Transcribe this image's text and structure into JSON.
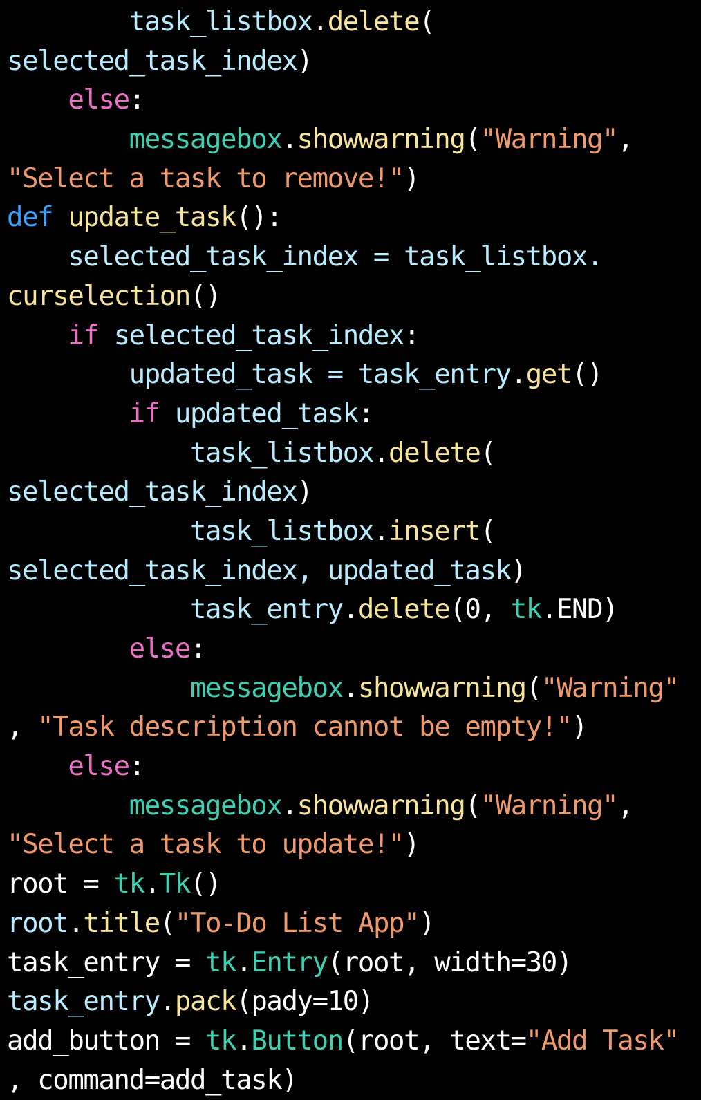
{
  "colors": {
    "background": "#000000",
    "plain": "#ffffff",
    "function": "#f6e59a",
    "keyword_def": "#3aa3ff",
    "keyword": "#ec6fc6",
    "string": "#ef9a6c",
    "module": "#3fd0b3",
    "property": "#b9ecff",
    "number": "#ffffff"
  },
  "lines": [
    [
      {
        "t": "        "
      },
      {
        "t": "task_listbox",
        "c": "property"
      },
      {
        "t": "."
      },
      {
        "t": "delete",
        "c": "function"
      },
      {
        "t": "("
      }
    ],
    [
      {
        "t": "selected_task_index",
        "c": "property"
      },
      {
        "t": ")"
      }
    ],
    [
      {
        "t": "    "
      },
      {
        "t": "else",
        "c": "keyword"
      },
      {
        "t": ":"
      }
    ],
    [
      {
        "t": "        "
      },
      {
        "t": "messagebox",
        "c": "module"
      },
      {
        "t": "."
      },
      {
        "t": "showwarning",
        "c": "function"
      },
      {
        "t": "("
      },
      {
        "t": "\"Warning\"",
        "c": "string"
      },
      {
        "t": ","
      }
    ],
    [
      {
        "t": "\"Select a task to remove!\"",
        "c": "string"
      },
      {
        "t": ")"
      }
    ],
    [
      {
        "t": "def",
        "c": "keyword_def"
      },
      {
        "t": " "
      },
      {
        "t": "update_task",
        "c": "function"
      },
      {
        "t": "():"
      }
    ],
    [
      {
        "t": "    "
      },
      {
        "t": "selected_task_index = task_listbox.",
        "c": "property"
      }
    ],
    [
      {
        "t": "curselection",
        "c": "function"
      },
      {
        "t": "()"
      }
    ],
    [
      {
        "t": "    "
      },
      {
        "t": "if",
        "c": "keyword"
      },
      {
        "t": " "
      },
      {
        "t": "selected_task_index",
        "c": "property"
      },
      {
        "t": ":"
      }
    ],
    [
      {
        "t": "        "
      },
      {
        "t": "updated_task = task_entry",
        "c": "property"
      },
      {
        "t": "."
      },
      {
        "t": "get",
        "c": "function"
      },
      {
        "t": "()"
      }
    ],
    [
      {
        "t": "        "
      },
      {
        "t": "if",
        "c": "keyword"
      },
      {
        "t": " "
      },
      {
        "t": "updated_task",
        "c": "property"
      },
      {
        "t": ":"
      }
    ],
    [
      {
        "t": "            "
      },
      {
        "t": "task_listbox",
        "c": "property"
      },
      {
        "t": "."
      },
      {
        "t": "delete",
        "c": "function"
      },
      {
        "t": "("
      }
    ],
    [
      {
        "t": "selected_task_index",
        "c": "property"
      },
      {
        "t": ")"
      }
    ],
    [
      {
        "t": "            "
      },
      {
        "t": "task_listbox",
        "c": "property"
      },
      {
        "t": "."
      },
      {
        "t": "insert",
        "c": "function"
      },
      {
        "t": "("
      }
    ],
    [
      {
        "t": "selected_task_index, updated_task",
        "c": "property"
      },
      {
        "t": ")"
      }
    ],
    [
      {
        "t": "            "
      },
      {
        "t": "task_entry",
        "c": "property"
      },
      {
        "t": "."
      },
      {
        "t": "delete",
        "c": "function"
      },
      {
        "t": "(0, "
      },
      {
        "t": "tk",
        "c": "module"
      },
      {
        "t": ".END)"
      }
    ],
    [
      {
        "t": "        "
      },
      {
        "t": "else",
        "c": "keyword"
      },
      {
        "t": ":"
      }
    ],
    [
      {
        "t": "            "
      },
      {
        "t": "messagebox",
        "c": "module"
      },
      {
        "t": "."
      },
      {
        "t": "showwarning",
        "c": "function"
      },
      {
        "t": "("
      },
      {
        "t": "\"Warning\"",
        "c": "string"
      }
    ],
    [
      {
        "t": ", "
      },
      {
        "t": "\"Task description cannot be empty!\"",
        "c": "string"
      },
      {
        "t": ")"
      }
    ],
    [
      {
        "t": "    "
      },
      {
        "t": "else",
        "c": "keyword"
      },
      {
        "t": ":"
      }
    ],
    [
      {
        "t": "        "
      },
      {
        "t": "messagebox",
        "c": "module"
      },
      {
        "t": "."
      },
      {
        "t": "showwarning",
        "c": "function"
      },
      {
        "t": "("
      },
      {
        "t": "\"Warning\"",
        "c": "string"
      },
      {
        "t": ","
      }
    ],
    [
      {
        "t": "\"Select a task to update!\"",
        "c": "string"
      },
      {
        "t": ")"
      }
    ],
    [
      {
        "t": "root = "
      },
      {
        "t": "tk",
        "c": "module"
      },
      {
        "t": "."
      },
      {
        "t": "Tk",
        "c": "module"
      },
      {
        "t": "()"
      }
    ],
    [
      {
        "t": "root",
        "c": "property"
      },
      {
        "t": "."
      },
      {
        "t": "title",
        "c": "function"
      },
      {
        "t": "("
      },
      {
        "t": "\"To-Do List App\"",
        "c": "string"
      },
      {
        "t": ")"
      }
    ],
    [
      {
        "t": "task_entry = "
      },
      {
        "t": "tk",
        "c": "module"
      },
      {
        "t": "."
      },
      {
        "t": "Entry",
        "c": "module"
      },
      {
        "t": "(root, width=30)"
      }
    ],
    [
      {
        "t": "task_entry",
        "c": "property"
      },
      {
        "t": "."
      },
      {
        "t": "pack",
        "c": "function"
      },
      {
        "t": "(pady=10)"
      }
    ],
    [
      {
        "t": "add_button = "
      },
      {
        "t": "tk",
        "c": "module"
      },
      {
        "t": "."
      },
      {
        "t": "Button",
        "c": "module"
      },
      {
        "t": "(root, text="
      },
      {
        "t": "\"Add Task\"",
        "c": "string"
      }
    ],
    [
      {
        "t": ", command=add_task)"
      }
    ]
  ]
}
